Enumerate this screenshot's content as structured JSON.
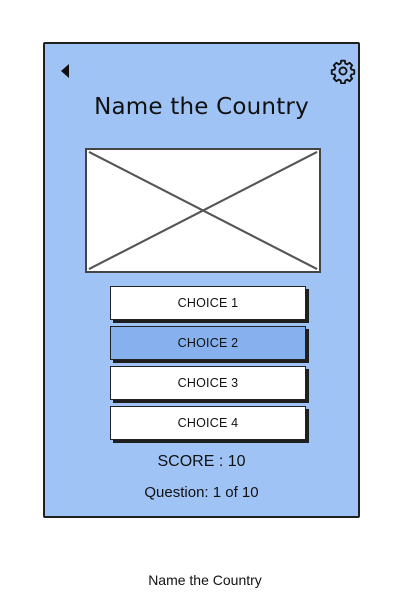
{
  "screen": {
    "title": "Name the Country",
    "back_icon": "back-triangle-icon",
    "settings_icon": "gear-icon",
    "image": "image-placeholder",
    "choices": [
      {
        "label": "CHOICE 1",
        "selected": false
      },
      {
        "label": "CHOICE 2",
        "selected": true
      },
      {
        "label": "CHOICE 3",
        "selected": false
      },
      {
        "label": "CHOICE 4",
        "selected": false
      }
    ],
    "score": "SCORE : 10",
    "question": "Question: 1 of 10"
  },
  "caption": "Name the Country",
  "colors": {
    "screen_background": "#9fc3f5",
    "selected_choice": "#87b1ee",
    "choice_background": "#ffffff",
    "border": "#1f1f1f"
  }
}
